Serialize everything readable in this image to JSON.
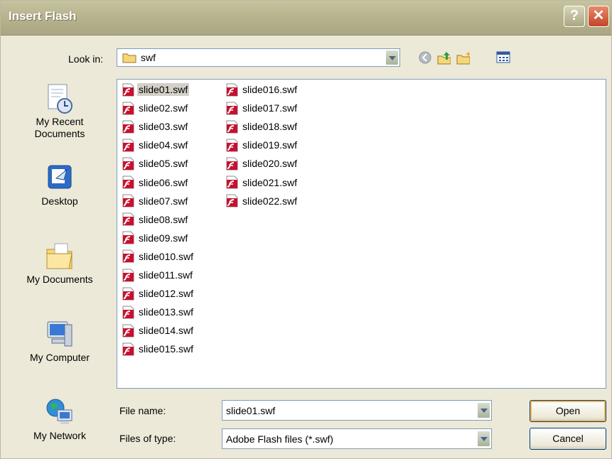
{
  "window": {
    "title": "Insert Flash"
  },
  "lookin": {
    "label": "Look in:",
    "value": "swf"
  },
  "places": [
    {
      "label_line1": "My Recent",
      "label_line2": "Documents",
      "icon": "recent-documents-icon"
    },
    {
      "label_line1": "Desktop",
      "label_line2": "",
      "icon": "desktop-icon"
    },
    {
      "label_line1": "My Documents",
      "label_line2": "",
      "icon": "my-documents-icon"
    },
    {
      "label_line1": "My Computer",
      "label_line2": "",
      "icon": "my-computer-icon"
    },
    {
      "label_line1": "My Network",
      "label_line2": "",
      "icon": "my-network-icon"
    }
  ],
  "files": [
    "slide01.swf",
    "slide02.swf",
    "slide03.swf",
    "slide04.swf",
    "slide05.swf",
    "slide06.swf",
    "slide07.swf",
    "slide08.swf",
    "slide09.swf",
    "slide010.swf",
    "slide011.swf",
    "slide012.swf",
    "slide013.swf",
    "slide014.swf",
    "slide015.swf",
    "slide016.swf",
    "slide017.swf",
    "slide018.swf",
    "slide019.swf",
    "slide020.swf",
    "slide021.swf",
    "slide022.swf"
  ],
  "selected_file": "slide01.swf",
  "filename": {
    "label": "File name:",
    "value": "slide01.swf"
  },
  "filetype": {
    "label": "Files of type:",
    "value": "Adobe Flash files (*.swf)"
  },
  "buttons": {
    "open": "Open",
    "cancel": "Cancel"
  },
  "colors": {
    "title_bar": "#b7b48f",
    "close": "#c2452a",
    "selection": "#d4d0c8",
    "flash_icon": "#c8102e"
  }
}
